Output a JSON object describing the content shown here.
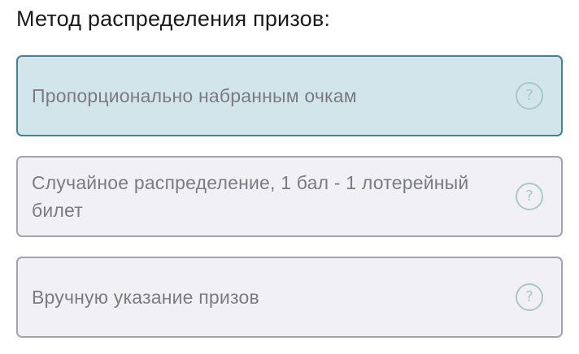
{
  "heading": "Метод распределения призов:",
  "options": [
    {
      "label": "Пропорционально набранным очкам",
      "selected": true,
      "help_icon": "question-circle-icon",
      "help_glyph": "?"
    },
    {
      "label": "Случайное распределение, 1 бал - 1 лотерейный билет",
      "selected": false,
      "help_icon": "question-circle-icon",
      "help_glyph": "?"
    },
    {
      "label": "Вручную указание призов",
      "selected": false,
      "help_icon": "question-circle-icon",
      "help_glyph": "?"
    }
  ],
  "colors": {
    "selected_border": "#3f8592",
    "selected_background": "#d2e5ea",
    "option_border": "#a3a3ab",
    "option_background": "#f1f0f5",
    "option_text": "#7a7c82",
    "help_icon": "#a9c9c4"
  }
}
